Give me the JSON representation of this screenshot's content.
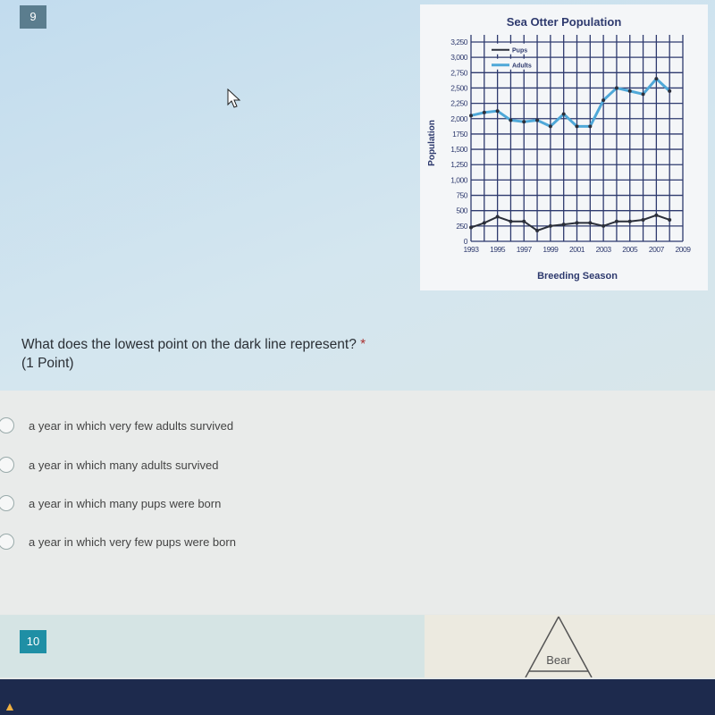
{
  "question9": {
    "number": "9",
    "text": "What does the lowest point on the dark line represent?",
    "required_mark": " *",
    "points": "(1 Point)",
    "options": [
      "a year in which very few adults survived",
      "a year in which many adults survived",
      "a year in which many pups were born",
      "a year in which very few pups were born"
    ]
  },
  "question10": {
    "number": "10",
    "diagram_label": "Bear"
  },
  "colors": {
    "adults": "#4fa8d8",
    "pups": "#2b2f3a",
    "grid": "#2e3a6e",
    "badge": "#1f8fa5"
  },
  "chart_data": {
    "type": "line",
    "title": "Sea Otter Population",
    "xlabel": "Breeding Season",
    "ylabel": "Population",
    "xlim": [
      1993,
      2009
    ],
    "ylim": [
      0,
      3250
    ],
    "grid": true,
    "legend_placement": "top-left",
    "x_ticks": [
      "1993",
      "1995",
      "1997",
      "1999",
      "2001",
      "2003",
      "2005",
      "2007",
      "2009"
    ],
    "y_ticks": [
      "0",
      "250",
      "500",
      "750",
      "1,000",
      "1,250",
      "1,500",
      "1750",
      "2,000",
      "2,250",
      "2,500",
      "2,750",
      "3,000",
      "3,250"
    ],
    "x": [
      1993,
      1994,
      1995,
      1996,
      1997,
      1998,
      1999,
      2000,
      2001,
      2002,
      2003,
      2004,
      2005,
      2006,
      2007,
      2008
    ],
    "series": [
      {
        "name": "Adults",
        "values": [
          2050,
          2100,
          2125,
          1975,
          1950,
          1975,
          1875,
          2075,
          1875,
          1875,
          2300,
          2500,
          2450,
          2400,
          2650,
          2450
        ]
      },
      {
        "name": "Pups",
        "values": [
          225,
          300,
          400,
          325,
          325,
          175,
          250,
          275,
          300,
          300,
          250,
          325,
          325,
          350,
          425,
          350
        ]
      }
    ]
  }
}
